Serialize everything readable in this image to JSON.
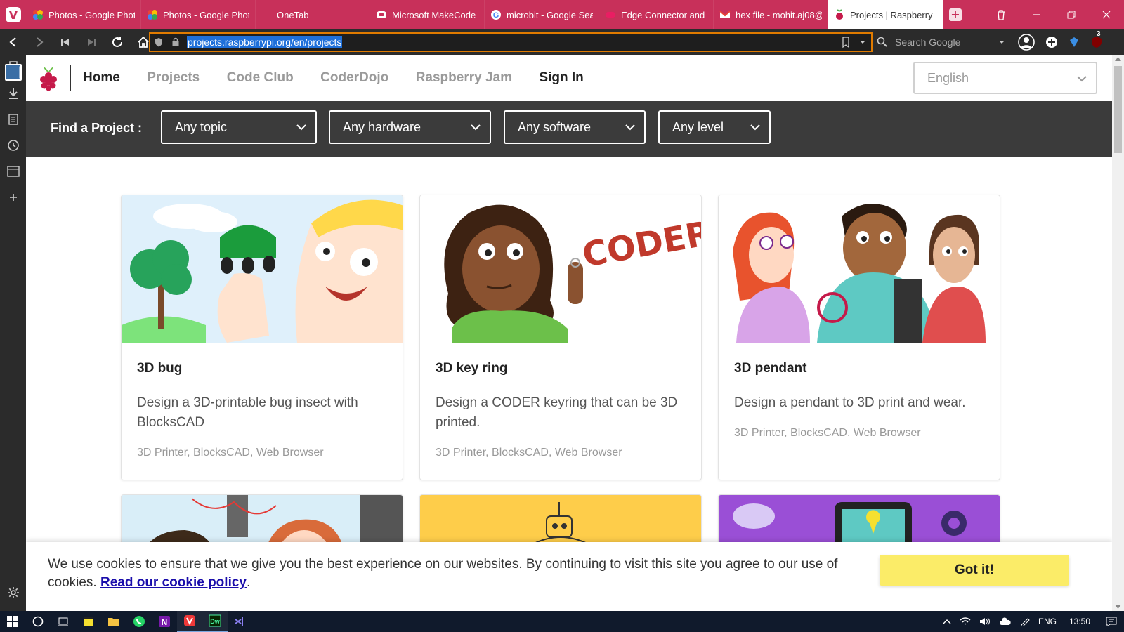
{
  "browser": {
    "tabs": [
      {
        "title": "Photos - Google Photos",
        "icon": "google-photos-icon",
        "active": false
      },
      {
        "title": "Photos - Google Photos",
        "icon": "google-photos-icon",
        "active": false
      },
      {
        "title": "OneTab",
        "icon": "onetab-icon",
        "active": false
      },
      {
        "title": "Microsoft MakeCode",
        "icon": "makecode-icon",
        "active": false
      },
      {
        "title": "microbit - Google Search",
        "icon": "google-icon",
        "active": false
      },
      {
        "title": "Edge Connector and",
        "icon": "edge-connector-icon",
        "active": false
      },
      {
        "title": "hex file - mohit.aj08@",
        "icon": "gmail-icon",
        "active": false
      },
      {
        "title": "Projects | Raspberry Pi",
        "icon": "raspberry-pi-icon",
        "active": true
      }
    ],
    "address": "projects.raspberrypi.org/en/projects",
    "search_placeholder": "Search Google",
    "badge_count": "3"
  },
  "site": {
    "nav": {
      "home": "Home",
      "projects": "Projects",
      "code_club": "Code Club",
      "coderdojo": "CoderDojo",
      "raspberry_jam": "Raspberry Jam",
      "sign_in": "Sign In"
    },
    "language": "English",
    "filters": {
      "label": "Find a Project :",
      "topic": "Any topic",
      "hardware": "Any hardware",
      "software": "Any software",
      "level": "Any level"
    }
  },
  "projects": [
    {
      "title": "3D bug",
      "description": "Design a 3D-printable bug insect with BlocksCAD",
      "tags": "3D Printer, BlocksCAD, Web Browser"
    },
    {
      "title": "3D key ring",
      "description": "Design a CODER keyring that can be 3D printed.",
      "tags": "3D Printer, BlocksCAD, Web Browser"
    },
    {
      "title": "3D pendant",
      "description": "Design a pendant to 3D print and wear.",
      "tags": "3D Printer, BlocksCAD, Web Browser"
    }
  ],
  "artwork": {
    "coder_sign": "CODER"
  },
  "cookie": {
    "message": "We use cookies to ensure that we give you the best experience on our websites. By continuing to visit this site you agree to our use of cookies.",
    "link": "Read our cookie policy",
    "button": "Got it!"
  },
  "taskbar": {
    "lang": "ENG",
    "time": "13:50"
  },
  "colors": {
    "vivaldi_red": "#c8305a",
    "filter_bar": "#3b3b3b",
    "cookie_button": "#fbec68",
    "url_focus": "#e07b00"
  }
}
